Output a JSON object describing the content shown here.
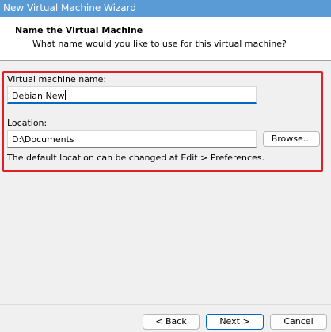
{
  "window": {
    "title": "New Virtual Machine Wizard"
  },
  "header": {
    "title": "Name the Virtual Machine",
    "subtitle": "What name would you like to use for this virtual machine?"
  },
  "form": {
    "vm_name_label": "Virtual machine name:",
    "vm_name_value": "Debian New",
    "location_label": "Location:",
    "location_value": "D:\\Documents",
    "browse_label": "Browse...",
    "hint": "The default location can be changed at Edit > Preferences."
  },
  "footer": {
    "back_label": "< Back",
    "next_label": "Next >",
    "cancel_label": "Cancel"
  },
  "colors": {
    "title_bar": "#5b9bd5",
    "highlight_border": "#e31e24",
    "focus_accent": "#0067c0"
  }
}
